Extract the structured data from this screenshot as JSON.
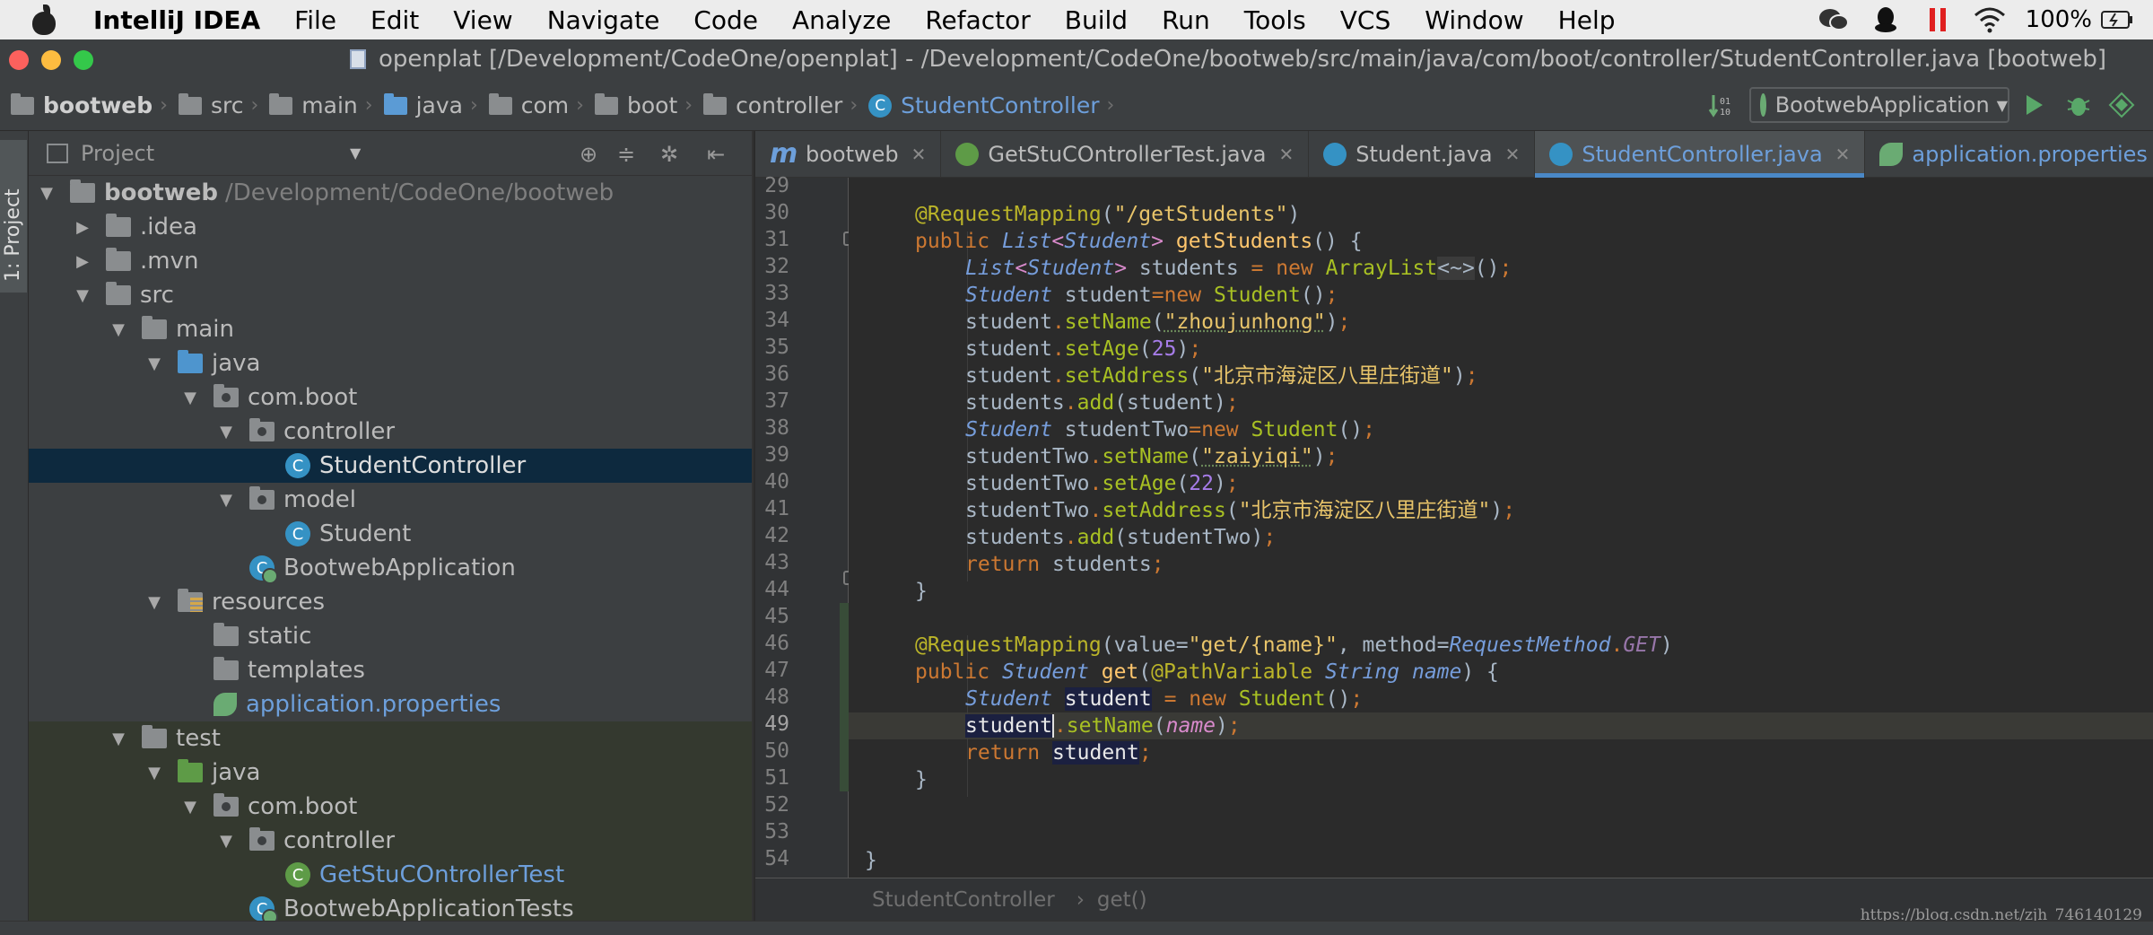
{
  "menubar": {
    "app_name": "IntelliJ IDEA",
    "items": [
      "File",
      "Edit",
      "View",
      "Navigate",
      "Code",
      "Analyze",
      "Refactor",
      "Build",
      "Run",
      "Tools",
      "VCS",
      "Window",
      "Help"
    ],
    "battery": "100%"
  },
  "window": {
    "title": "openplat [/Development/CodeOne/openplat] - /Development/CodeOne/bootweb/src/main/java/com/boot/controller/StudentController.java [bootweb]"
  },
  "navbar": {
    "crumbs": [
      "bootweb",
      "src",
      "main",
      "java",
      "com",
      "boot",
      "controller",
      "StudentController"
    ],
    "run_config": "BootwebApplication"
  },
  "toolstrip": {
    "project_tab": "1: Project"
  },
  "project_panel": {
    "header": "Project",
    "tree": [
      {
        "label": "bootweb",
        "sub": "/Development/CodeOne/bootweb"
      },
      {
        "label": ".idea"
      },
      {
        "label": ".mvn"
      },
      {
        "label": "src"
      },
      {
        "label": "main"
      },
      {
        "label": "java"
      },
      {
        "label": "com.boot"
      },
      {
        "label": "controller"
      },
      {
        "label": "StudentController"
      },
      {
        "label": "model"
      },
      {
        "label": "Student"
      },
      {
        "label": "BootwebApplication"
      },
      {
        "label": "resources"
      },
      {
        "label": "static"
      },
      {
        "label": "templates"
      },
      {
        "label": "application.properties"
      },
      {
        "label": "test"
      },
      {
        "label": "java"
      },
      {
        "label": "com.boot"
      },
      {
        "label": "controller"
      },
      {
        "label": "GetStuCOntrollerTest"
      },
      {
        "label": "BootwebApplicationTests"
      }
    ]
  },
  "tabs": [
    "bootweb",
    "GetStuCOntrollerTest.java",
    "Student.java",
    "StudentController.java",
    "application.properties"
  ],
  "editor": {
    "line_numbers": [
      "29",
      "30",
      "31",
      "32",
      "33",
      "34",
      "35",
      "36",
      "37",
      "38",
      "39",
      "40",
      "41",
      "42",
      "43",
      "44",
      "45",
      "46",
      "47",
      "48",
      "49",
      "50",
      "51",
      "52",
      "53",
      "54"
    ],
    "strings": {
      "mapping1": "\"/getStudents\"",
      "name1": "\"zhoujunhong\"",
      "addr": "\"北京市海淀区八里庄街道\"",
      "name2": "\"zaiyiqi\"",
      "mapping2": "\"get/{name}\"",
      "age1": "25",
      "age2": "22"
    },
    "breadcrumb": [
      "StudentController",
      "get()"
    ]
  },
  "watermark": "https://blog.csdn.net/zjh_746140129",
  "colors": {
    "accent": "#4a88c7",
    "selection": "#0d293e",
    "editor_bg": "#2b2b2b"
  }
}
